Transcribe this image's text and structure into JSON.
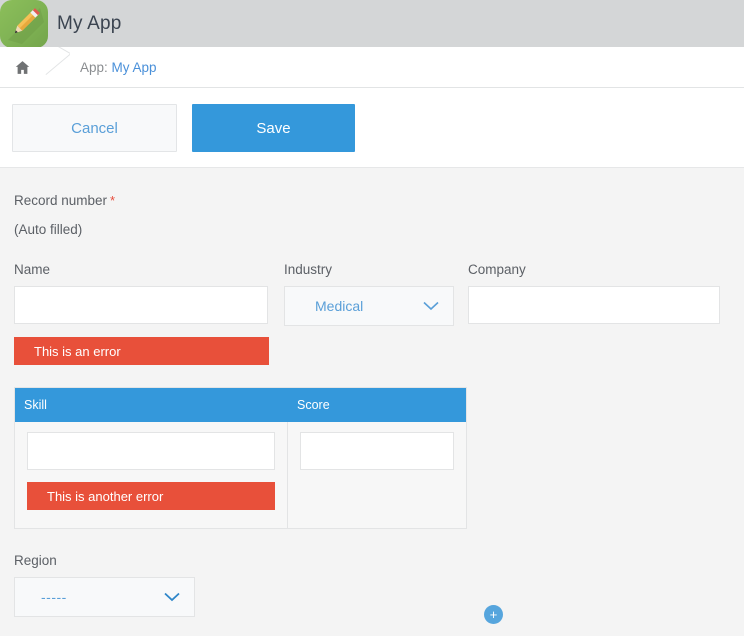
{
  "header": {
    "app_title": "My App",
    "app_icon": "pencil-icon",
    "icon_bg": "#7fb254"
  },
  "breadcrumb": {
    "home_icon": "home-icon",
    "prefix": "App: ",
    "link": "My App",
    "link_color": "#4a90d9"
  },
  "toolbar": {
    "cancel_label": "Cancel",
    "save_label": "Save",
    "save_color": "#3498db"
  },
  "form": {
    "record_number": {
      "label": "Record number",
      "required_mark": "*",
      "value": "(Auto filled)"
    },
    "name": {
      "label": "Name",
      "value": "",
      "error": "This is an error"
    },
    "industry": {
      "label": "Industry",
      "value": "Medical",
      "chevron": "chevron-down-icon"
    },
    "company": {
      "label": "Company",
      "value": ""
    },
    "table": {
      "columns": [
        "Skill",
        "Score"
      ],
      "rows": [
        {
          "skill": "",
          "score": "",
          "skill_error": "This is another error"
        }
      ],
      "header_color": "#3498db",
      "add_label": "+"
    },
    "region": {
      "label": "Region",
      "value": "-----",
      "chevron": "chevron-down-icon"
    },
    "error_color": "#e8503a"
  }
}
